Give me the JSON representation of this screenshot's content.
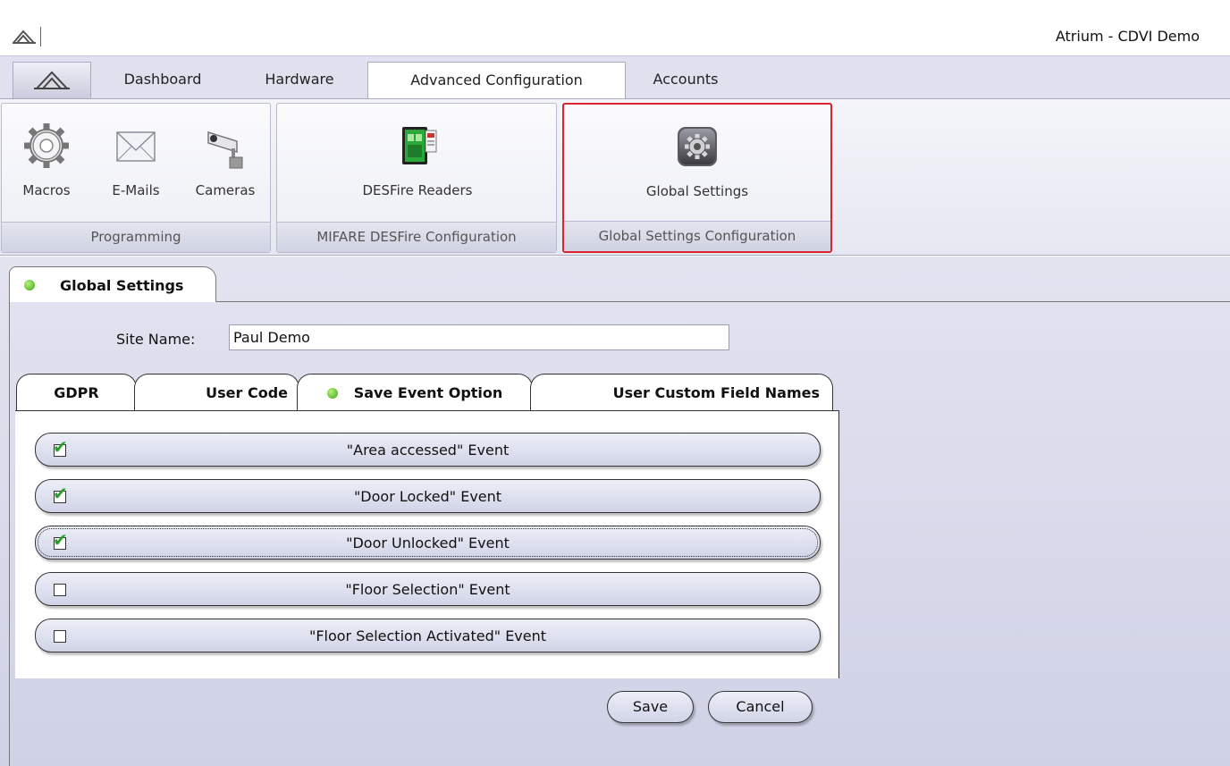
{
  "window": {
    "title": "Atrium - CDVI Demo"
  },
  "ribbon_tabs": [
    {
      "label": "Dashboard"
    },
    {
      "label": "Hardware"
    },
    {
      "label": "Advanced Configuration",
      "active": true
    },
    {
      "label": "Accounts"
    }
  ],
  "ribbon_groups": {
    "programming": {
      "label": "Programming",
      "buttons": [
        "Macros",
        "E-Mails",
        "Cameras"
      ]
    },
    "mifare": {
      "label": "MIFARE DESFire Configuration",
      "buttons": [
        "DESFire Readers"
      ]
    },
    "global": {
      "label": "Global Settings Configuration",
      "buttons": [
        "Global Settings"
      ]
    }
  },
  "document_tab": {
    "label": "Global Settings",
    "status": "active"
  },
  "site": {
    "label": "Site Name:",
    "value": "Paul Demo"
  },
  "inner_tabs": [
    {
      "label": "GDPR"
    },
    {
      "label": "User Code"
    },
    {
      "label": "Save Event Option",
      "active": true
    },
    {
      "label": "User Custom Field Names"
    }
  ],
  "events": [
    {
      "label": "\"Area accessed\" Event",
      "checked": true
    },
    {
      "label": "\"Door Locked\" Event",
      "checked": true
    },
    {
      "label": "\"Door Unlocked\" Event",
      "checked": true
    },
    {
      "label": "\"Floor Selection\" Event",
      "checked": false
    },
    {
      "label": "\"Floor Selection Activated\" Event",
      "checked": false
    }
  ],
  "actions": {
    "save": "Save",
    "cancel": "Cancel"
  },
  "colors": {
    "highlight": "#d9232e",
    "status_green": "#3aa41a",
    "ribbon_bg": "#dfe1ee"
  }
}
